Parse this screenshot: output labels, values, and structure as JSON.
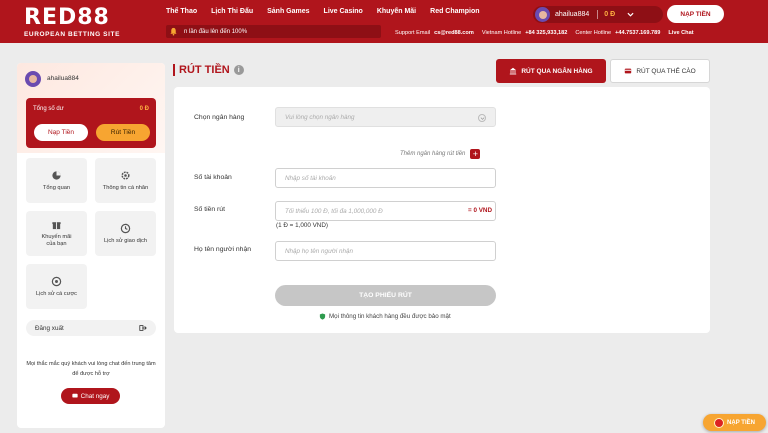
{
  "brand": {
    "logo_text": "RED88",
    "tagline": "EUROPEAN BETTING SITE"
  },
  "nav": [
    {
      "label": "Thể Thao"
    },
    {
      "label": "Lịch Thi Đấu"
    },
    {
      "label": "Sảnh Games"
    },
    {
      "label": "Live Casino"
    },
    {
      "label": "Khuyến Mãi"
    },
    {
      "label": "Red Champion"
    }
  ],
  "marquee": {
    "text": "n lần đầu lên đến 100%"
  },
  "user": {
    "name": "ahailua884",
    "balance": "0 Đ"
  },
  "header": {
    "deposit_label": "NẠP TIỀN",
    "support_email_label": "Support Email",
    "support_email": "cs@red88.com",
    "vn_hotline_label": "Vietnam Hotline",
    "vn_hotline": "+84 325,933,182",
    "center_hotline_label": "Center Hotline",
    "center_hotline": "+44.7537.169.789",
    "live_chat": "Live Chat"
  },
  "sidebar": {
    "user_name": "ahailua884",
    "balance_label": "Tổng số dư",
    "balance_value": "0 Đ",
    "deposit_button": "Nạp Tiền",
    "withdraw_button": "Rút Tiền",
    "tiles": [
      {
        "label": "Tổng quan",
        "icon": "pie-chart-icon"
      },
      {
        "label": "Thông tin cá nhân",
        "icon": "gear-icon"
      },
      {
        "label": "Khuyến mãi\ncủa bạn",
        "icon": "gift-icon"
      },
      {
        "label": "Lịch sử giao dịch",
        "icon": "clock-icon"
      },
      {
        "label": "Lịch sử cá cược",
        "icon": "ball-icon"
      }
    ],
    "logout_label": "Đăng xuất",
    "help_text": "Mọi thắc mắc quý khách vui lòng chat đến trung tâm để được hỗ trợ",
    "chat_button": "Chat ngay"
  },
  "main": {
    "title": "RÚT TIỀN",
    "tab_bank": "RÚT QUA NGÂN HÀNG",
    "tab_card": "RÚT QUA THẺ CÀO",
    "bank_label": "Chọn ngân hàng",
    "bank_placeholder": "Vui lòng chọn ngân hàng",
    "add_bank": "Thêm ngân hàng rút tiền",
    "account_label": "Số tài khoản",
    "account_placeholder": "Nhập số tài khoản",
    "amount_label": "Số tiền rút",
    "amount_placeholder": "Tối thiểu 100 Đ, tối đa 1,000,000 Đ",
    "amount_suffix": "= 0 VND",
    "rate_text": "(1 Đ = 1,000 VND)",
    "receiver_label": "Họ tên người nhận",
    "receiver_placeholder": "Nhập họ tên người nhận",
    "submit": "TẠO PHIẾU RÚT",
    "secure_text": "Mọi thông tin khách hàng đều được bảo mật"
  },
  "float_button": {
    "label": "NẠP TIỀN"
  }
}
